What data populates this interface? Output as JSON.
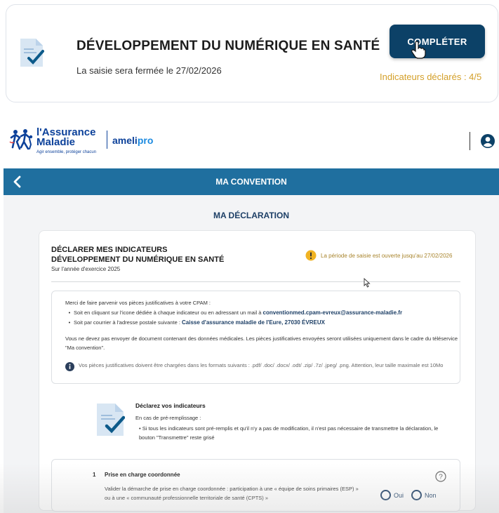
{
  "top_card": {
    "title": "DÉVELOPPEMENT DU NUMÉRIQUE EN SANTÉ",
    "subtitle": "La saisie sera fermée le 27/02/2026",
    "button_label": "COMPLÉTER",
    "indicators": "Indicateurs déclarés : 4/5",
    "icon": "document-check-icon"
  },
  "header": {
    "logo_line1": "l'Assurance",
    "logo_line2": "Maladie",
    "logo_tagline": "Agir ensemble, protéger chacun",
    "product_prefix": "ameli",
    "product_suffix": "pro",
    "user_icon": "user-icon"
  },
  "nav_bar": {
    "title": "MA CONVENTION",
    "back_icon": "chevron-left-icon"
  },
  "page": {
    "section_title": "MA DÉCLARATION"
  },
  "declaration": {
    "title_line1": "DÉCLARER MES INDICATEURS",
    "title_line2": "DÉVELOPPEMENT DU NUMÉRIQUE EN SANTÉ",
    "year": "Sur l'année d'exercice 2025",
    "period": "La période de saisie est ouverte jusqu'au 27/02/2026"
  },
  "info_box": {
    "intro": "Merci de faire parvenir vos pièces justificatives à votre CPAM :",
    "bullet1": "Soit en cliquant sur l'icone dédiée à chaque indicateur ou en adressant un mail à ",
    "bullet1_link": "conventionmed.cpam-evreux@assurance-maladie.fr",
    "bullet2": "Soit par courrier à l'adresse postale suivante : ",
    "bullet2_link": "Caisse d'assurance maladie de l'Eure, 27030 ÉVREUX",
    "para": "Vous ne devez pas envoyer de document contenant des données médicales. Les pièces justificatives envoyées seront utilisées uniquement dans le cadre du téléservice \"Ma convention\".",
    "formats": "Vos pièces justificatives doivent être chargées dans les formats suivants : .pdf/ .doc/ .docx/ .odt/ .zip/ .7z/ .jpeg/ .png. Attention, leur taille maximale est 10Mo"
  },
  "declare_block": {
    "title": "Déclarez vos indicateurs",
    "subtitle": "En cas de pré-remplissage :",
    "bullet": "Si tous les indicateurs sont pré-remplis et qu'il n'y a pas de modification, il n'est pas nécessaire de transmettre la déclaration, le bouton \"Transmettre\" reste grisé"
  },
  "question": {
    "number": "1",
    "title": "Prise en charge coordonnée",
    "text": "Valider la démarche de prise en charge coordonnée : participation à une « équipe de soins primaires (ESP) » ou à une « communauté professionnelle territoriale de santé (CPTS) »",
    "yes": "Oui",
    "no": "Non"
  },
  "colors": {
    "primary_dark": "#0c4167",
    "nav_blue": "#1f6f9f",
    "warning": "#d4a02a",
    "brand_blue": "#0c419a"
  }
}
